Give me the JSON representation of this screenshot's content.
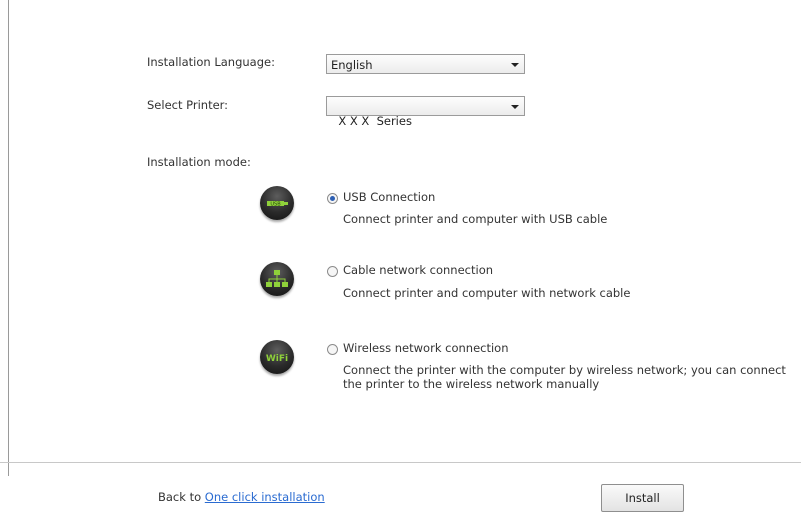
{
  "form": {
    "language_label": "Installation Language:",
    "language_value": "English",
    "printer_label": "Select Printer:",
    "printer_value": "X X X  Series",
    "mode_label": "Installation mode:"
  },
  "modes": [
    {
      "title": "USB Connection",
      "description": "Connect printer and computer with USB cable",
      "icon": "usb-icon",
      "selected": true
    },
    {
      "title": "Cable network connection",
      "description": "Connect printer and computer with network cable",
      "icon": "network-icon",
      "selected": false
    },
    {
      "title": "Wireless network connection",
      "description_line1": "Connect the printer with the computer by wireless network; you can connect",
      "description_line2": "the printer to the wireless network manually",
      "icon": "wifi-icon",
      "icon_text": "WiFi",
      "selected": false
    }
  ],
  "footer": {
    "back_prefix": "Back to",
    "back_link": "One click installation",
    "install_label": "Install"
  },
  "colors": {
    "link": "#2a6bd1",
    "radio_selected": "#2d5fb3",
    "icon_green": "#8fd13a"
  }
}
